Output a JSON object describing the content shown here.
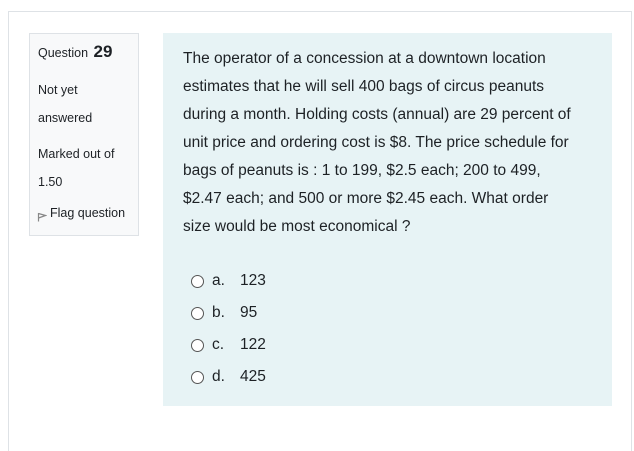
{
  "question": {
    "label": "Question",
    "number": "29",
    "state_line1": "Not yet",
    "state_line2": "answered",
    "grade_line1": "Marked out of",
    "grade_line2": "1.50",
    "flag_label": "Flag question"
  },
  "qtext": {
    "lines": [
      "The operator of a concession at a downtown location",
      "estimates that he will sell 400 bags of circus peanuts",
      "during a month. Holding costs (annual) are 29 percent of",
      "unit price and ordering cost is $8. The price schedule for",
      "bags of peanuts is : 1 to 199, $2.5 each; 200 to 499,",
      "$2.47 each; and 500 or more $2.45 each. What order",
      "size would be most economical ?"
    ]
  },
  "answers": [
    {
      "letter": "a.",
      "value": "123"
    },
    {
      "letter": "b.",
      "value": "95"
    },
    {
      "letter": "c.",
      "value": "122"
    },
    {
      "letter": "d.",
      "value": "425"
    }
  ],
  "icons": {
    "flag": "flag-icon",
    "radio": "radio-unchecked-icon"
  }
}
